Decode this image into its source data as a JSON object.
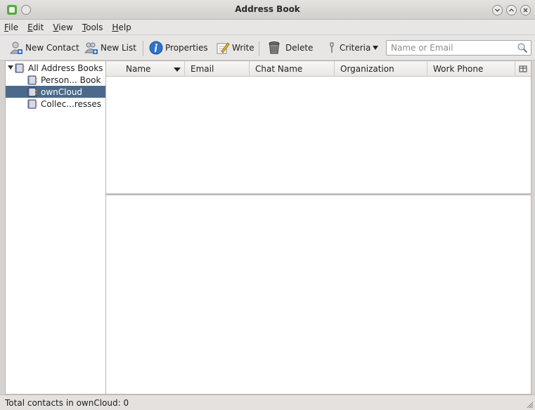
{
  "window": {
    "title": "Address Book"
  },
  "menu": {
    "items": [
      {
        "first": "F",
        "rest": "ile"
      },
      {
        "first": "E",
        "rest": "dit"
      },
      {
        "first": "V",
        "rest": "iew"
      },
      {
        "first": "T",
        "rest": "ools"
      },
      {
        "first": "H",
        "rest": "elp"
      }
    ]
  },
  "toolbar": {
    "new_contact": "New Contact",
    "new_list": "New List",
    "properties": "Properties",
    "write": "Write",
    "delete": "Delete",
    "criteria": "Criteria",
    "search_placeholder": "Name or Email"
  },
  "sidebar": {
    "root": "All Address Books",
    "items": [
      {
        "label": "Person... Book",
        "selected": false
      },
      {
        "label": "ownCloud",
        "selected": true
      },
      {
        "label": "Collec...resses",
        "selected": false
      }
    ]
  },
  "columns": [
    "Name",
    "Email",
    "Chat Name",
    "Organization",
    "Work Phone"
  ],
  "status": {
    "text": "Total contacts in ownCloud: 0"
  },
  "colors": {
    "selection": "#4b6a8b",
    "window_bg": "#d6d2d0"
  }
}
